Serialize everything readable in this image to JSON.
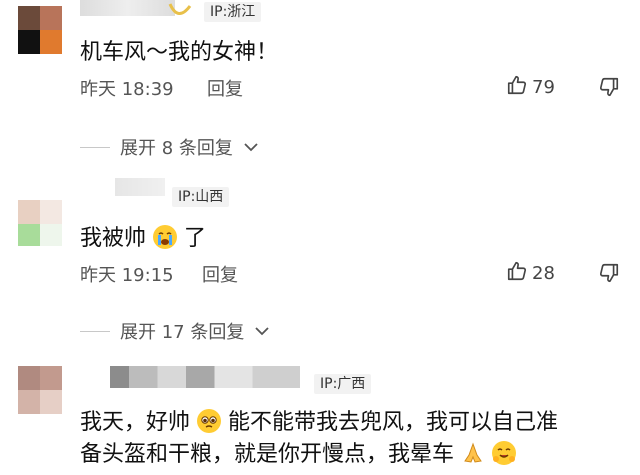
{
  "comments": [
    {
      "ip": "IP:浙江",
      "text": "机车风～我的女神！",
      "time": "昨天 18:39",
      "reply_label": "回复",
      "likes": "79",
      "expand": "展开 8 条回复"
    },
    {
      "ip": "IP:山西",
      "text_a": "我被帅",
      "text_b": "了",
      "time": "昨天 19:15",
      "reply_label": "回复",
      "likes": "28",
      "expand": "展开 17 条回复"
    },
    {
      "ip": "IP:广西",
      "line1_a": "我天，好帅",
      "line1_b": "能不能带我去兜风，我可以自己准",
      "line2": "备头盔和干粮，就是你开慢点，我晕车"
    }
  ],
  "colors": {
    "ip_bg": "#f2f2f2",
    "meta_text": "#555555",
    "emoji_yellow": "#ffcc33"
  }
}
